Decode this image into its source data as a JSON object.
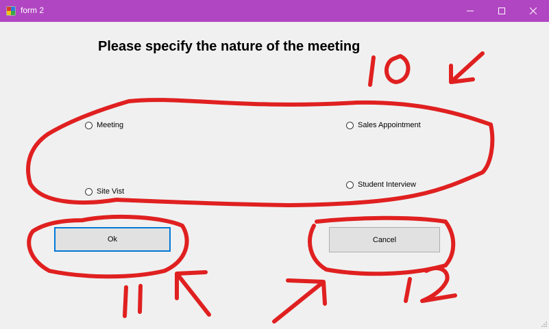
{
  "window": {
    "title": "form 2",
    "titlebar_color": "#b146c2",
    "icons": [
      "app-icon",
      "minimize-icon",
      "maximize-icon",
      "close-icon"
    ]
  },
  "form": {
    "heading": "Please specify the nature of the meeting",
    "options": [
      {
        "label": "Meeting",
        "checked": false
      },
      {
        "label": "Sales Appointment",
        "checked": false
      },
      {
        "label": "Site Vist",
        "checked": false
      },
      {
        "label": "Student Interview",
        "checked": false
      }
    ],
    "ok_label": "Ok",
    "cancel_label": "Cancel",
    "focus_color": "#0078d7"
  },
  "annotations": {
    "color": "#e02020",
    "labels": [
      "10",
      "11",
      "12"
    ]
  }
}
